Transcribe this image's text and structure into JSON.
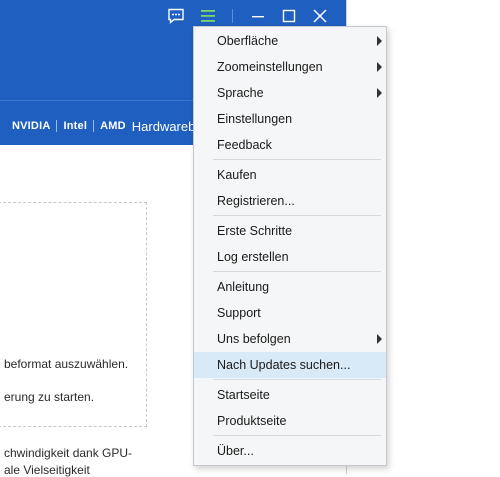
{
  "colors": {
    "header_bg": "#1f5fbf",
    "menu_bg": "#f5f6f7",
    "menu_highlight": "#d8eaf7"
  },
  "titlebar": {
    "icons": [
      "feedback-chat-icon",
      "hamburger-menu-icon",
      "minimize-icon",
      "maximize-icon",
      "close-icon"
    ]
  },
  "vendor_bar": {
    "vendors": [
      "NVIDIA",
      "Intel",
      "AMD"
    ],
    "hardware_text": "Hardwarebesc"
  },
  "content": {
    "line1": "beformat auszuwählen.",
    "line2": "erung zu starten.",
    "line3": "chwindigkeit dank GPU-",
    "line4": "ale Vielseitigkeit"
  },
  "menu": {
    "items": [
      {
        "label": "Oberfläche",
        "submenu": true
      },
      {
        "label": "Zoomeinstellungen",
        "submenu": true
      },
      {
        "label": "Sprache",
        "submenu": true
      },
      {
        "label": "Einstellungen",
        "submenu": false
      },
      {
        "label": "Feedback",
        "submenu": false
      },
      {
        "label": "Kaufen",
        "submenu": false
      },
      {
        "label": "Registrieren...",
        "submenu": false
      },
      {
        "label": "Erste Schritte",
        "submenu": false
      },
      {
        "label": "Log erstellen",
        "submenu": false
      },
      {
        "label": "Anleitung",
        "submenu": false
      },
      {
        "label": "Support",
        "submenu": false
      },
      {
        "label": "Uns befolgen",
        "submenu": true
      },
      {
        "label": "Nach Updates suchen...",
        "submenu": false,
        "highlighted": true
      },
      {
        "label": "Startseite",
        "submenu": false
      },
      {
        "label": "Produktseite",
        "submenu": false
      },
      {
        "label": "Über...",
        "submenu": false
      }
    ]
  }
}
